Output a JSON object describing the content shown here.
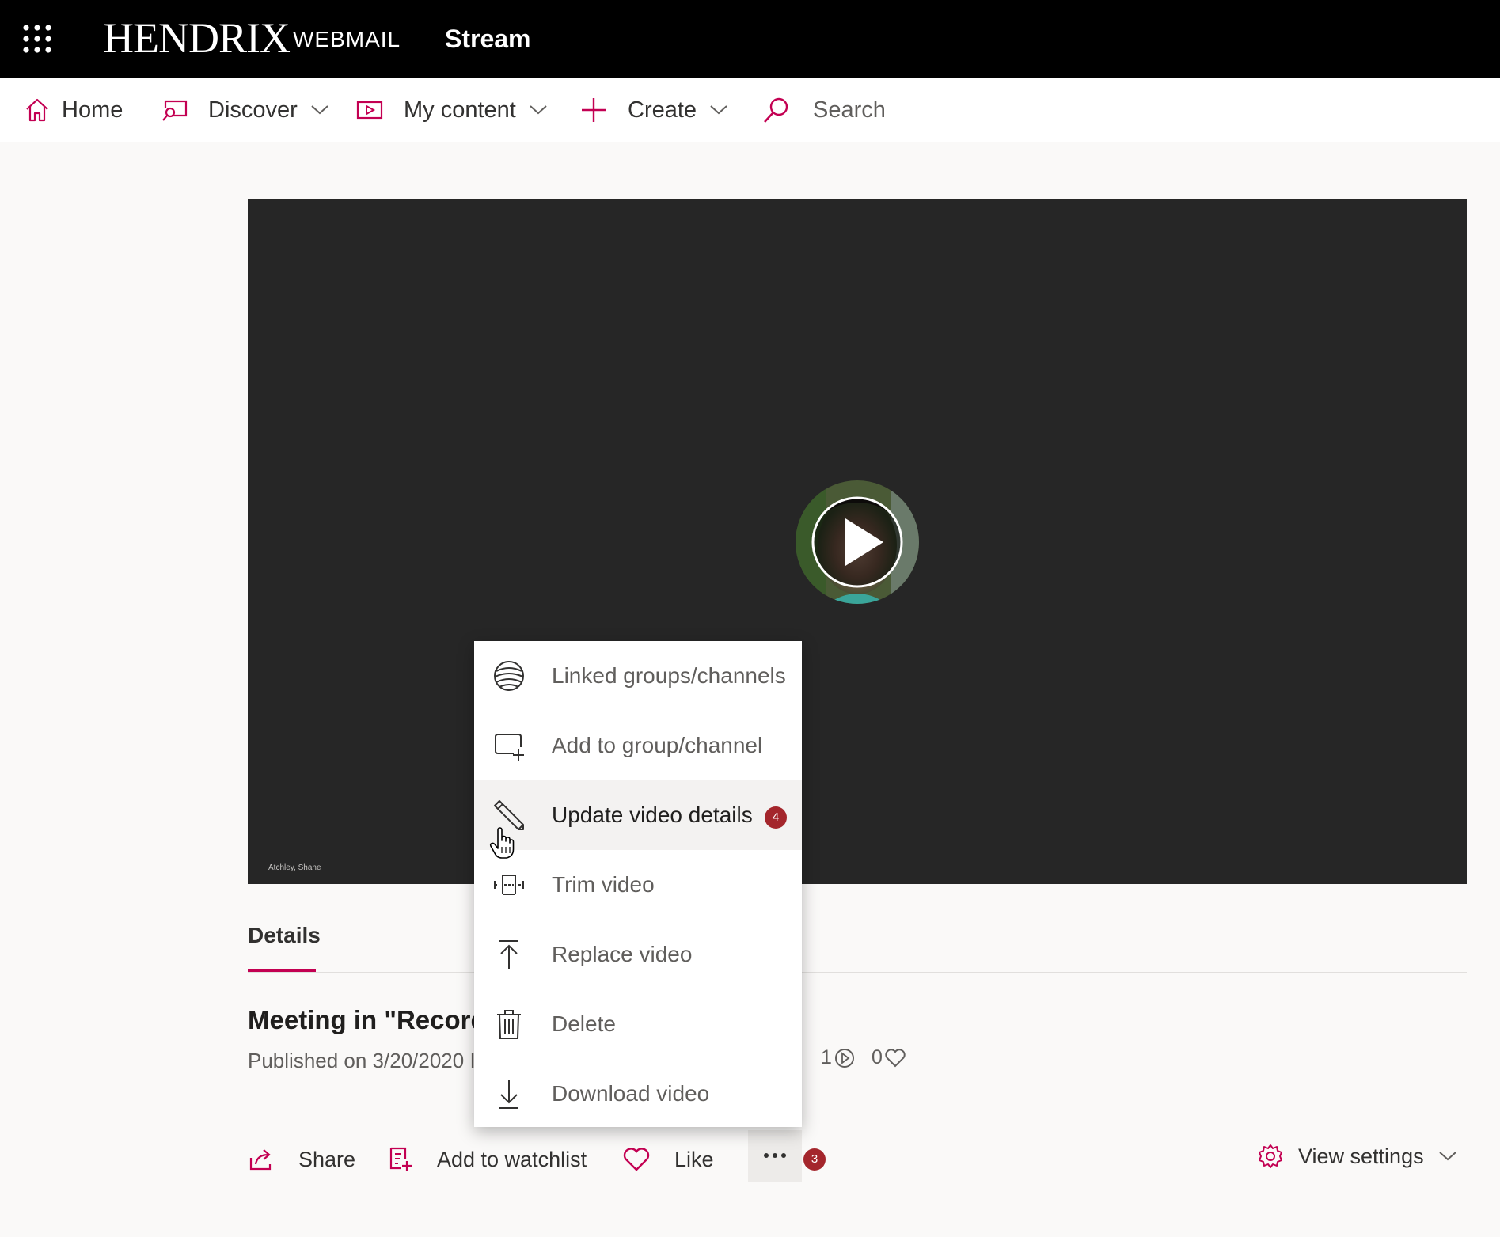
{
  "header": {
    "brand_primary": "HENDRIX",
    "brand_secondary": "WEBMAIL",
    "app_title": "Stream"
  },
  "nav": {
    "home": "Home",
    "discover": "Discover",
    "my_content": "My content",
    "create": "Create",
    "search_placeholder": "Search"
  },
  "video": {
    "caption": "Atchley, Shane"
  },
  "details": {
    "tab_label": "Details",
    "title": "Meeting in \"Recordi",
    "published": "Published on 3/20/2020 I",
    "views": "1",
    "likes": "0"
  },
  "actions": {
    "share": "Share",
    "add_to_watchlist": "Add to watchlist",
    "like": "Like",
    "more_badge": "3",
    "view_settings": "View settings"
  },
  "menu": {
    "items": [
      {
        "label": "Linked groups/channels",
        "icon": "globe-icon"
      },
      {
        "label": "Add to group/channel",
        "icon": "add-to-group-icon"
      },
      {
        "label": "Update video details",
        "icon": "pencil-icon",
        "badge": "4"
      },
      {
        "label": "Trim video",
        "icon": "trim-icon"
      },
      {
        "label": "Replace video",
        "icon": "upload-icon"
      },
      {
        "label": "Delete",
        "icon": "trash-icon"
      },
      {
        "label": "Download video",
        "icon": "download-icon"
      }
    ]
  },
  "colors": {
    "accent": "#c30052",
    "topbar": "#000000",
    "badge": "#a4262c",
    "video_bg": "#262626"
  }
}
